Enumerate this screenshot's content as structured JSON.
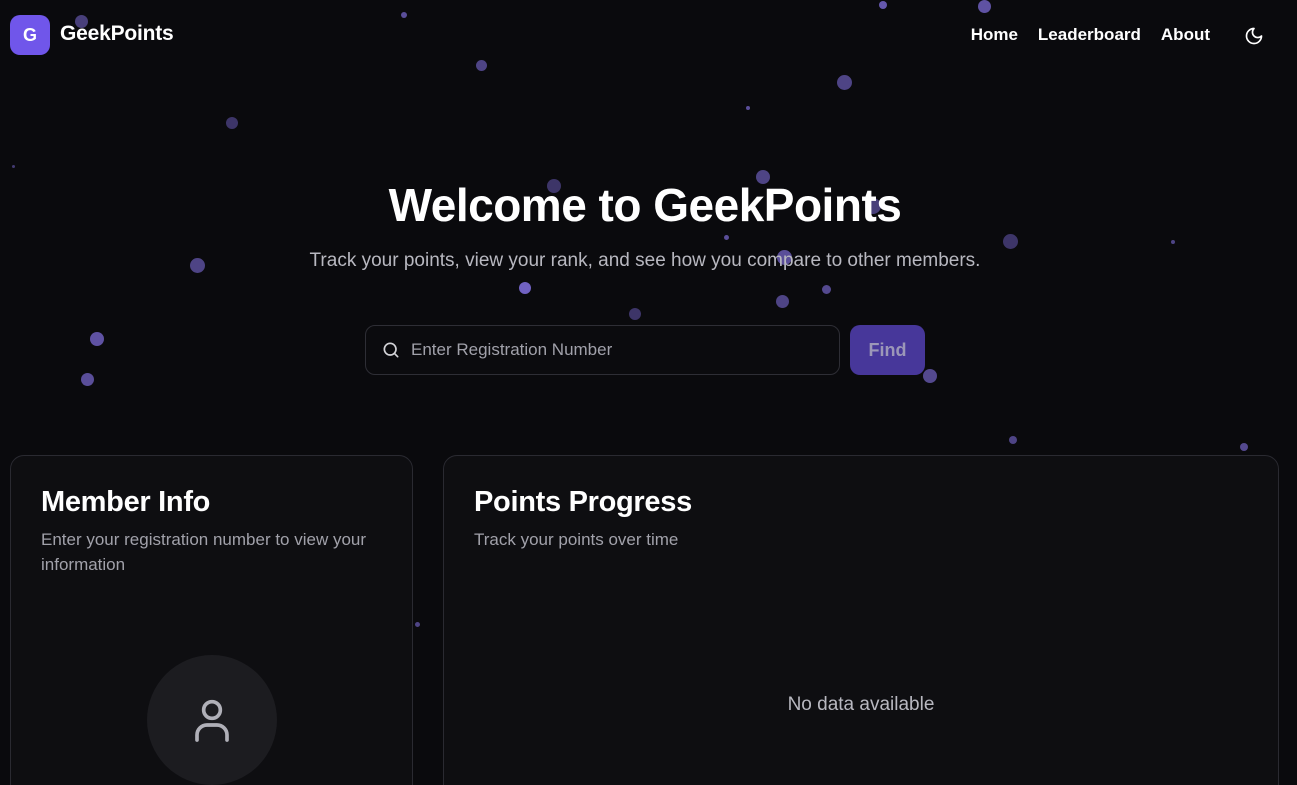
{
  "brand": {
    "logo_letter": "G",
    "name": "GeekPoints"
  },
  "nav": {
    "links": [
      "Home",
      "Leaderboard",
      "About"
    ],
    "theme_icon": "moon-icon"
  },
  "hero": {
    "title": "Welcome to GeekPoints",
    "subtitle": "Track your points, view your rank, and see how you compare to other members."
  },
  "search": {
    "placeholder": "Enter Registration Number",
    "value": "",
    "icon": "search-icon",
    "button_label": "Find"
  },
  "member_card": {
    "title": "Member Info",
    "subtitle": "Enter your registration number to view your information",
    "avatar_icon": "user-icon"
  },
  "points_card": {
    "title": "Points Progress",
    "subtitle": "Track your points over time",
    "empty_message": "No data available"
  },
  "colors": {
    "background": "#0a0a0d",
    "accent": "#7056ea",
    "button": "#47379a",
    "particle": "#7c6bd6"
  }
}
